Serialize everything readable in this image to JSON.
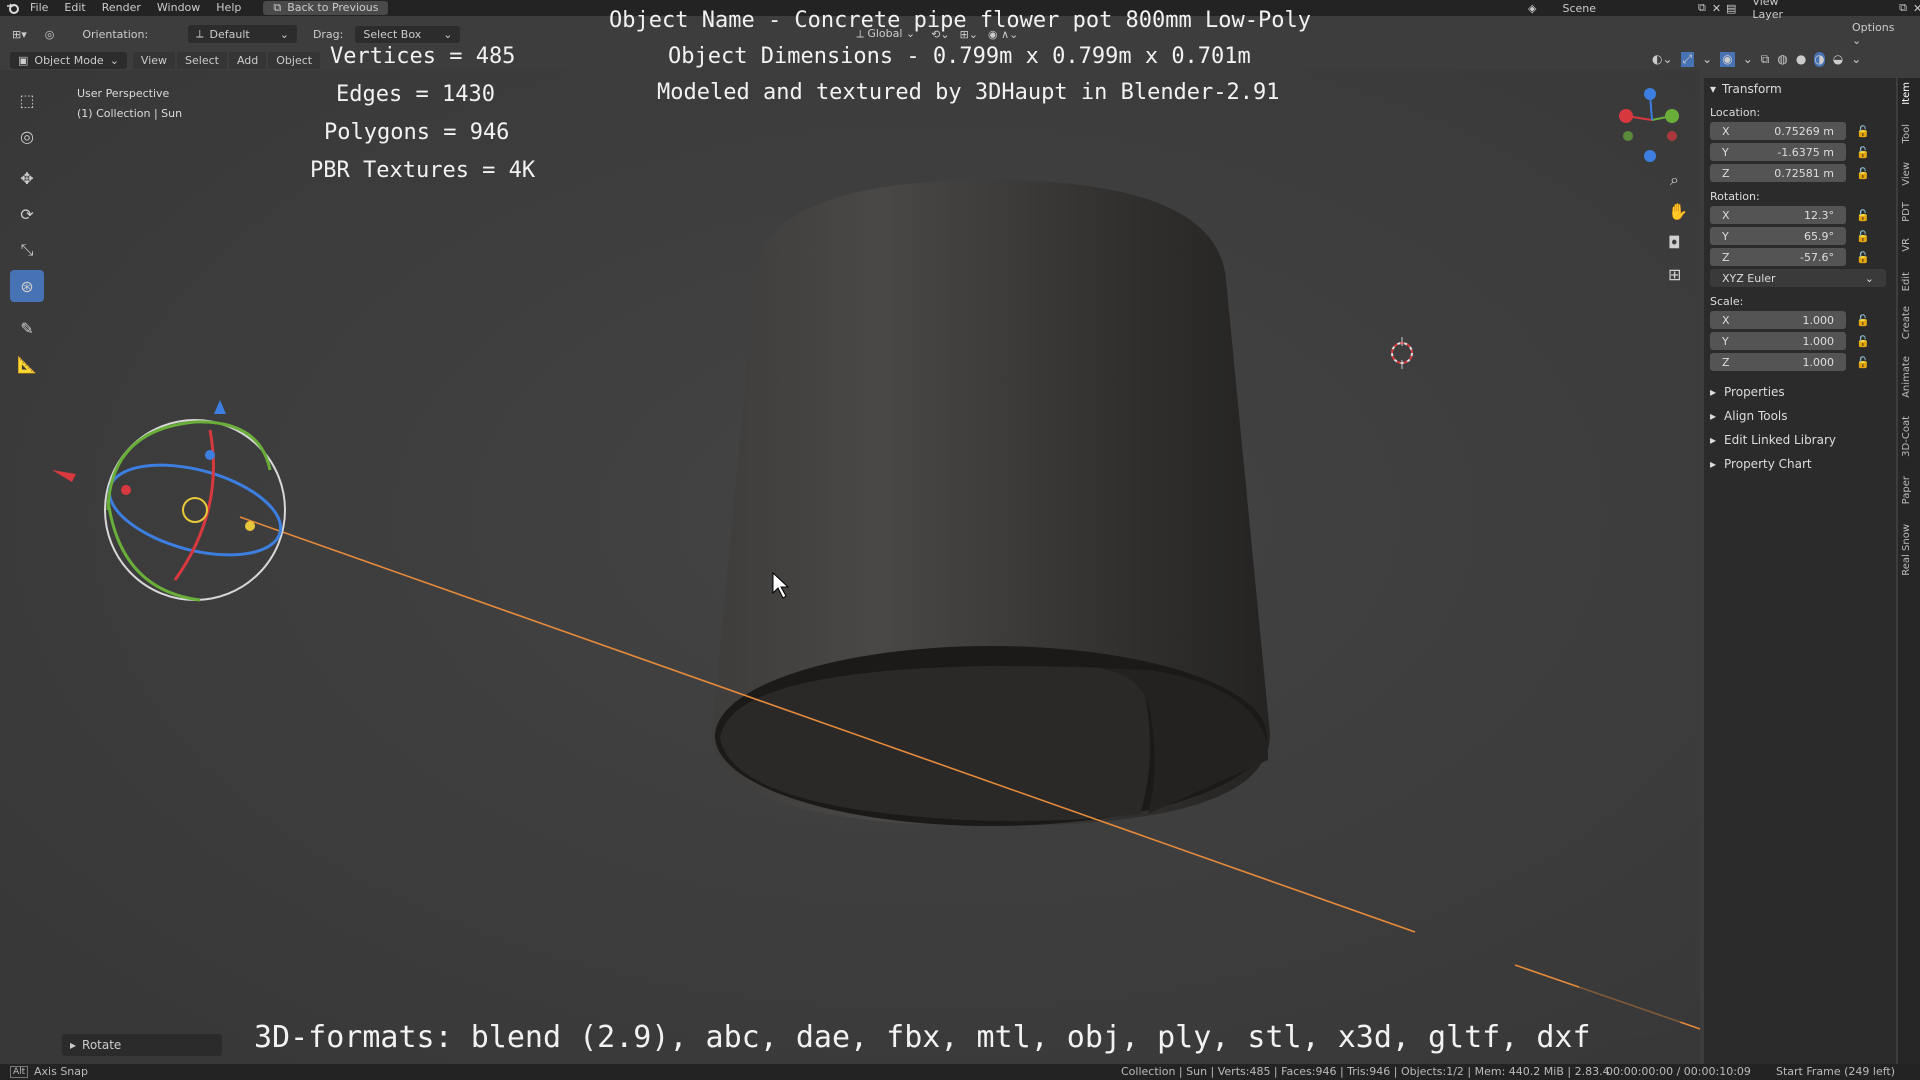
{
  "topbar": {
    "menu": [
      "File",
      "Edit",
      "Render",
      "Window",
      "Help"
    ],
    "back": "Back to Previous",
    "scene": "Scene",
    "view_layer": "View Layer"
  },
  "header": {
    "orientation_label": "Orientation:",
    "orientation_value": "Default",
    "drag_label": "Drag:",
    "drag_value": "Select Box",
    "transform_space": "Global",
    "options": "Options"
  },
  "header3": {
    "mode": "Object Mode",
    "view": "View",
    "select": "Select",
    "add": "Add",
    "object": "Object"
  },
  "overlay": {
    "vertices": "Vertices = 485",
    "edges": "Edges = 1430",
    "polygons": "Polygons = 946",
    "pbr": "PBR Textures = 4K",
    "name": "Object Name - Concrete pipe flower pot 800mm Low-Poly",
    "dims": "Object Dimensions -  0.799m x 0.799m x 0.701m",
    "modeled": "Modeled and textured by 3DHaupt in Blender-2.91",
    "formats": "3D-formats: blend (2.9), abc, dae, fbx, mtl, obj, ply, stl, x3d, gltf, dxf"
  },
  "viewport": {
    "perspective": "User Perspective",
    "collection": "(1) Collection | Sun"
  },
  "npanel": {
    "transform": "Transform",
    "location_label": "Location:",
    "location": [
      {
        "axis": "X",
        "value": "0.75269 m"
      },
      {
        "axis": "Y",
        "value": "-1.6375 m"
      },
      {
        "axis": "Z",
        "value": "0.72581 m"
      }
    ],
    "rotation_label": "Rotation:",
    "rotation": [
      {
        "axis": "X",
        "value": "12.3°"
      },
      {
        "axis": "Y",
        "value": "65.9°"
      },
      {
        "axis": "Z",
        "value": "-57.6°"
      }
    ],
    "rotation_mode": "XYZ Euler",
    "scale_label": "Scale:",
    "scale": [
      {
        "axis": "X",
        "value": "1.000"
      },
      {
        "axis": "Y",
        "value": "1.000"
      },
      {
        "axis": "Z",
        "value": "1.000"
      }
    ],
    "collapsed": [
      "Properties",
      "Align Tools",
      "Edit Linked Library",
      "Property Chart"
    ]
  },
  "tabs": [
    "Item",
    "Tool",
    "View",
    "PDT",
    "VR",
    "Edit",
    "Create",
    "Animate",
    "3D-Coat",
    "Paper",
    "Real Snow"
  ],
  "rotate_panel": "Rotate",
  "status": {
    "left": "Axis Snap",
    "alt": "Alt",
    "stats": "Collection | Sun | Verts:485 | Faces:946 | Tris:946 | Objects:1/2 | Mem: 440.2 MiB | 2.83.4",
    "time": "00:00:00:00 / 00:00:10:09",
    "frame": "Start Frame (249 left)"
  },
  "colors": {
    "active_tool": "#4772b3",
    "viewport": "#3d3d3d",
    "panel": "#2b2b2b"
  }
}
